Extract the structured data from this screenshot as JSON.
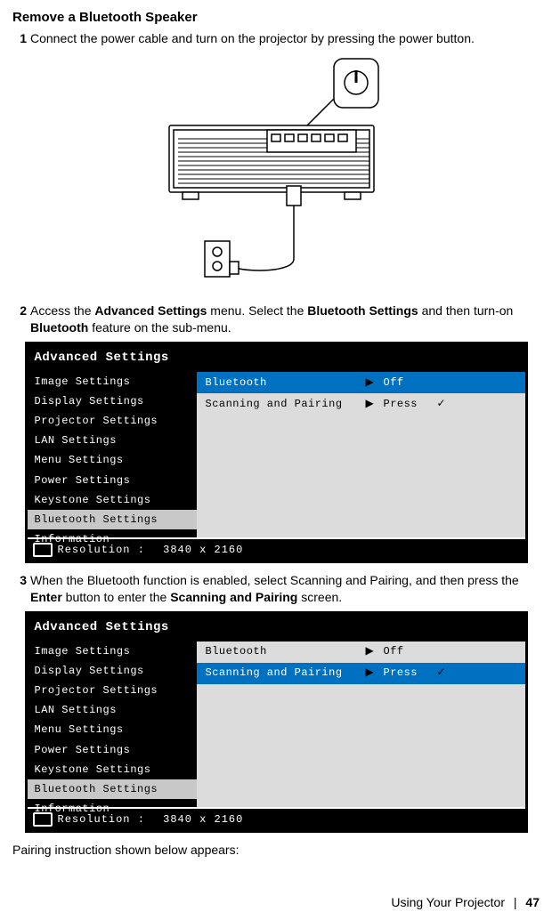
{
  "heading": "Remove a Bluetooth Speaker",
  "steps": {
    "s1": {
      "n": "1",
      "text_a": "Connect the power cable and turn on the projector by pressing the power button."
    },
    "s2": {
      "n": "2",
      "pre": "Access the ",
      "bold1": "Advanced Settings",
      "mid1": " menu. Select the ",
      "bold2": "Bluetooth Settings",
      "mid2": " and then turn-on ",
      "bold3": "Bluetooth",
      "post": " feature on the sub-menu."
    },
    "s3": {
      "n": "3",
      "pre": "When the Bluetooth function is enabled, select Scanning and Pairing, and then press the ",
      "bold1": "Enter",
      "mid1": " button to enter the ",
      "bold2": "Scanning and Pairing",
      "post": " screen."
    }
  },
  "menu": {
    "title": "Advanced Settings",
    "left": [
      "Image Settings",
      "Display Settings",
      "Projector Settings",
      "LAN Settings",
      "Menu Settings",
      "Power Settings",
      "Keystone Settings",
      "Bluetooth Settings",
      "Information"
    ],
    "rows": [
      {
        "label": "Bluetooth",
        "arrow": "▶",
        "value": "Off",
        "check": ""
      },
      {
        "label": "Scanning and Pairing",
        "arrow": "▶",
        "value": "Press",
        "check": "✓"
      }
    ],
    "res_label": "Resolution :",
    "res_value": "3840 x 2160"
  },
  "pairing_note": "Pairing instruction shown below appears:",
  "footer": {
    "section": "Using Your Projector",
    "page": "47"
  }
}
